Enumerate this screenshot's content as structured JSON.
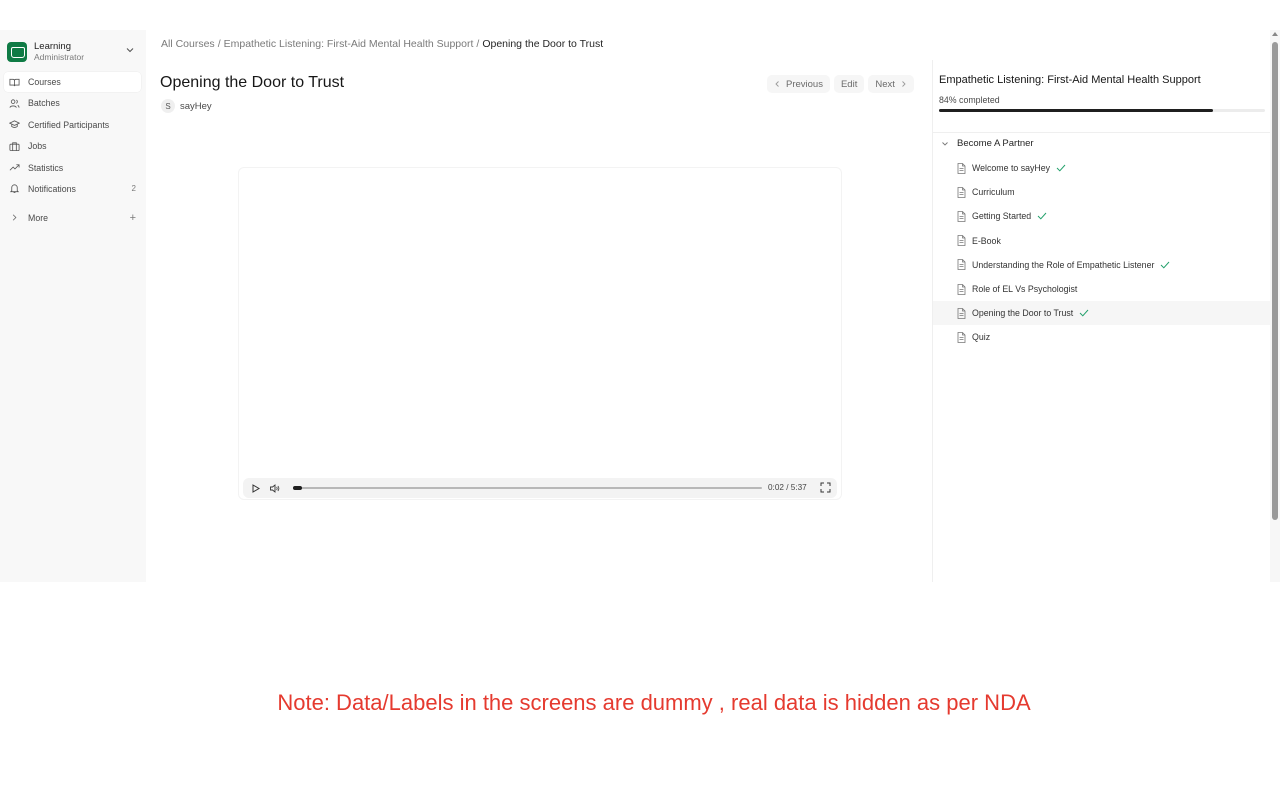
{
  "sidebar": {
    "brand_title": "Learning",
    "brand_subtitle": "Administrator",
    "items": [
      {
        "label": "Courses",
        "icon": "book-icon",
        "active": true
      },
      {
        "label": "Batches",
        "icon": "users-icon"
      },
      {
        "label": "Certified Participants",
        "icon": "graduation-cap-icon"
      },
      {
        "label": "Jobs",
        "icon": "briefcase-icon"
      },
      {
        "label": "Statistics",
        "icon": "trending-up-icon"
      },
      {
        "label": "Notifications",
        "icon": "bell-icon",
        "badge": "2"
      }
    ],
    "more_label": "More"
  },
  "breadcrumb": {
    "items": [
      "All Courses",
      "Empathetic Listening: First-Aid Mental Health Support",
      "Opening the Door to Trust"
    ],
    "separator": "/"
  },
  "lesson": {
    "title": "Opening the Door to Trust",
    "author_initial": "S",
    "author_name": "sayHey",
    "previous_label": "Previous",
    "edit_label": "Edit",
    "next_label": "Next"
  },
  "player": {
    "time": "0:02 / 5:37",
    "progress": 0.02
  },
  "course_panel": {
    "title": "Empathetic Listening: First-Aid Mental Health Support",
    "completion_text": "84% completed",
    "completion": 0.84,
    "section_title": "Become A Partner",
    "lessons": [
      {
        "label": "Welcome to sayHey",
        "done": true
      },
      {
        "label": "Curriculum",
        "done": false
      },
      {
        "label": "Getting Started",
        "done": true
      },
      {
        "label": "E-Book",
        "done": false
      },
      {
        "label": "Understanding the Role of Empathetic Listener",
        "done": true
      },
      {
        "label": "Role of EL Vs Psychologist",
        "done": false
      },
      {
        "label": "Opening the Door to Trust",
        "done": true,
        "active": true
      },
      {
        "label": "Quiz",
        "done": false
      }
    ]
  },
  "note": "Note: Data/Labels in the screens are dummy , real data is hidden as per NDA",
  "colors": {
    "brand": "#0f7b45",
    "check": "#22a06b",
    "note": "#e53a2f"
  }
}
